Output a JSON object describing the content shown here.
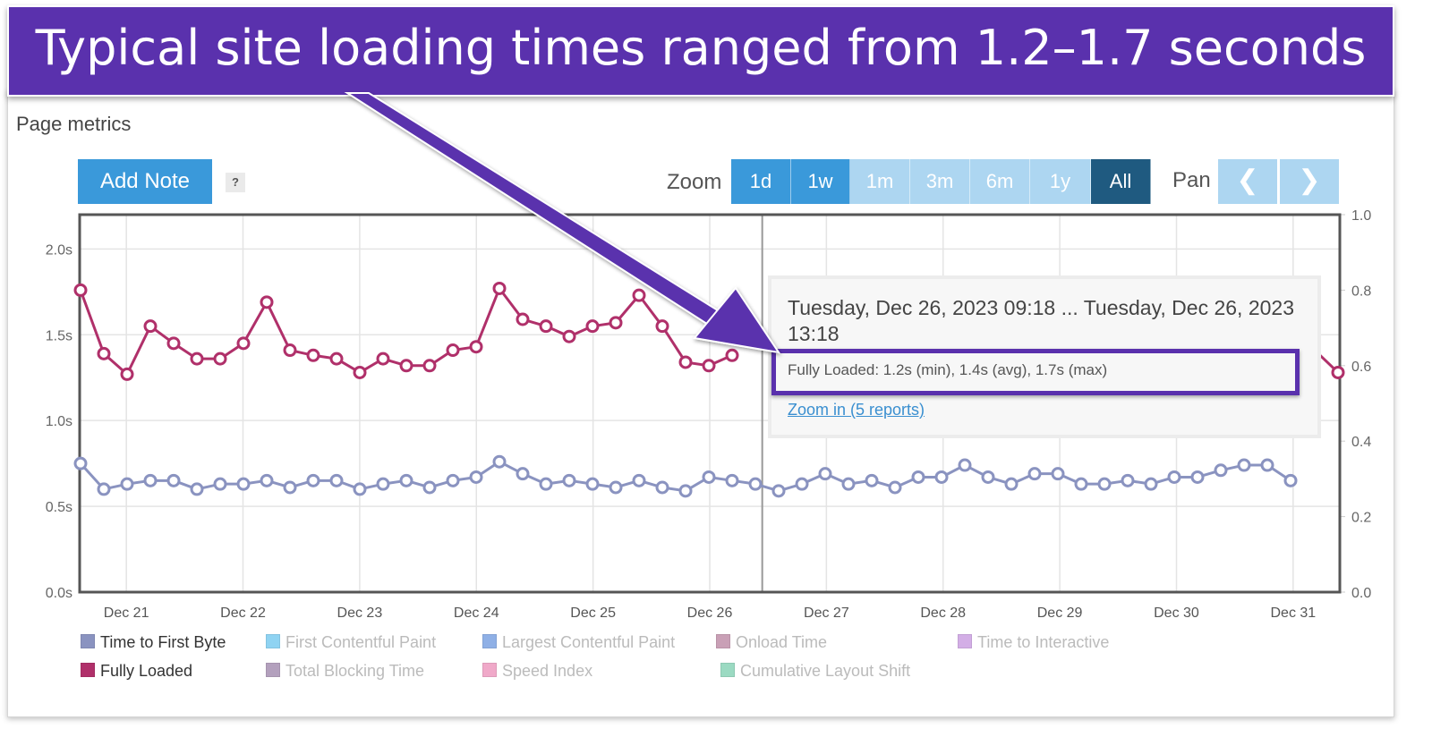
{
  "banner": {
    "text": "Typical site loading times ranged from 1.2–1.7 seconds"
  },
  "panel": {
    "title": "Page metrics"
  },
  "toolbar": {
    "add_note_label": "Add Note",
    "help_label": "?",
    "zoom_label": "Zoom",
    "zoom_options": [
      {
        "label": "1d",
        "state": "enabled"
      },
      {
        "label": "1w",
        "state": "enabled"
      },
      {
        "label": "1m",
        "state": "disabled"
      },
      {
        "label": "3m",
        "state": "disabled"
      },
      {
        "label": "6m",
        "state": "disabled"
      },
      {
        "label": "1y",
        "state": "disabled"
      },
      {
        "label": "All",
        "state": "selected"
      }
    ],
    "pan_label": "Pan",
    "pan_prev_icon": "chevron-left-icon",
    "pan_next_icon": "chevron-right-icon"
  },
  "colors": {
    "banner": "#5a31ad",
    "button_blue": "#3a99da",
    "button_light": "#add6f1",
    "button_selected": "#1f5a80",
    "fully_loaded": "#b0306a",
    "ttfb": "#8a93c0"
  },
  "tooltip": {
    "title": "Tuesday, Dec 26, 2023 09:18 ... Tuesday, Dec 26, 2023 13:18",
    "metric_line": "Fully Loaded: 1.2s (min), 1.4s (avg), 1.7s (max)",
    "link": "Zoom in (5 reports)"
  },
  "chart_data": {
    "type": "line",
    "title": "Page metrics",
    "xlabel": "",
    "ylabel": "",
    "x_tick_labels": [
      "Dec 21",
      "Dec 22",
      "Dec 23",
      "Dec 24",
      "Dec 25",
      "Dec 26",
      "Dec 27",
      "Dec 28",
      "Dec 29",
      "Dec 30",
      "Dec 31"
    ],
    "y_left": {
      "ticks": [
        "0.0s",
        "0.5s",
        "1.0s",
        "1.5s",
        "2.0s"
      ],
      "range": [
        0,
        2.2
      ]
    },
    "y_right": {
      "ticks": [
        "0.0",
        "0.2",
        "0.4",
        "0.6",
        "0.8",
        "1.0"
      ],
      "range": [
        0,
        1.0
      ]
    },
    "x_range_days": [
      20.6,
      31.4
    ],
    "crosshair_day": 26.45,
    "grid": true,
    "legend_placement": "bottom",
    "series": [
      {
        "name": "Fully Loaded",
        "color": "#b0306a",
        "visible": true,
        "values": [
          1.76,
          1.39,
          1.27,
          1.55,
          1.45,
          1.36,
          1.36,
          1.45,
          1.69,
          1.41,
          1.38,
          1.36,
          1.28,
          1.36,
          1.32,
          1.32,
          1.41,
          1.43,
          1.77,
          1.59,
          1.55,
          1.49,
          1.55,
          1.57,
          1.73,
          1.55,
          1.34,
          1.32,
          1.38,
          null,
          null,
          null,
          null,
          null,
          null,
          null,
          null,
          null,
          null,
          null,
          null,
          null,
          null,
          null,
          null,
          null,
          null,
          null,
          null,
          null,
          null,
          null,
          null,
          1.41,
          1.28
        ]
      },
      {
        "name": "Time to First Byte",
        "color": "#8a93c0",
        "visible": true,
        "values": [
          0.75,
          0.6,
          0.63,
          0.65,
          0.65,
          0.6,
          0.63,
          0.63,
          0.65,
          0.61,
          0.65,
          0.65,
          0.6,
          0.63,
          0.65,
          0.61,
          0.65,
          0.67,
          0.76,
          0.69,
          0.63,
          0.65,
          0.63,
          0.61,
          0.65,
          0.61,
          0.59,
          0.67,
          0.65,
          0.63,
          0.59,
          0.63,
          0.69,
          0.63,
          0.65,
          0.61,
          0.67,
          0.67,
          0.74,
          0.67,
          0.63,
          0.69,
          0.69,
          0.63,
          0.63,
          0.65,
          0.63,
          0.67,
          0.67,
          0.71,
          0.74,
          0.74,
          0.65
        ]
      }
    ],
    "legend": [
      {
        "name": "Time to First Byte",
        "color": "#8a93c0",
        "visible": true
      },
      {
        "name": "First Contentful Paint",
        "color": "#8fd3f2",
        "visible": false
      },
      {
        "name": "Largest Contentful Paint",
        "color": "#8fb0e6",
        "visible": false
      },
      {
        "name": "Onload Time",
        "color": "#c9a0b6",
        "visible": false
      },
      {
        "name": "Time to Interactive",
        "color": "#d3aee6",
        "visible": false
      },
      {
        "name": "Fully Loaded",
        "color": "#b0306a",
        "visible": true
      },
      {
        "name": "Total Blocking Time",
        "color": "#b3a0bd",
        "visible": false
      },
      {
        "name": "Speed Index",
        "color": "#f0a9c9",
        "visible": false
      },
      {
        "name": "Cumulative Layout Shift",
        "color": "#9bdac2",
        "visible": false
      }
    ]
  }
}
